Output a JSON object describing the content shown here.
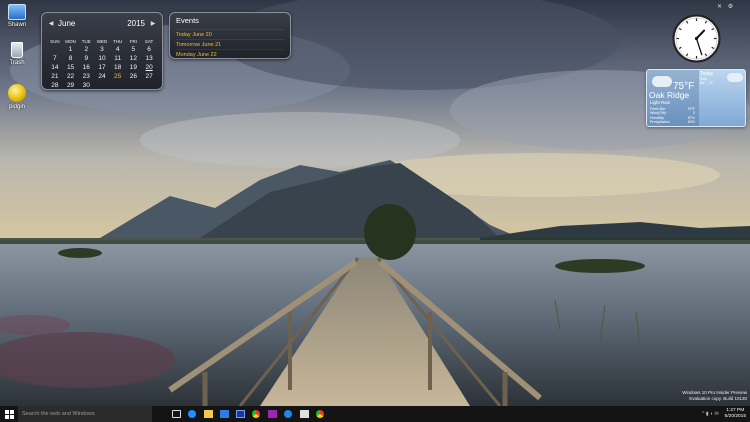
{
  "desktop": {
    "icons": [
      {
        "name": "user-folder",
        "label": "Shawn"
      },
      {
        "name": "recycle-bin",
        "label": "Trash"
      },
      {
        "name": "pidgin",
        "label": "pidgin"
      }
    ]
  },
  "calendar": {
    "month": "June",
    "year": "2015",
    "prev_icon": "chevron-left-icon",
    "next_icon": "chevron-right-icon",
    "weekdays": [
      "SUN",
      "MON",
      "TUE",
      "WED",
      "THU",
      "FRI",
      "SAT"
    ],
    "weeks": [
      [
        "",
        "1",
        "2",
        "3",
        "4",
        "5",
        "6"
      ],
      [
        "7",
        "8",
        "9",
        "10",
        "11",
        "12",
        "13"
      ],
      [
        "14",
        "15",
        "16",
        "17",
        "18",
        "19",
        "20"
      ],
      [
        "21",
        "22",
        "23",
        "24",
        "25",
        "26",
        "27"
      ],
      [
        "28",
        "29",
        "30",
        "",
        "",
        "",
        ""
      ]
    ],
    "today": "25",
    "underlined": "20",
    "today_color": "#f0c020"
  },
  "events": {
    "title": "Events",
    "items": [
      "Today June 20",
      "Tomorrow June 21",
      "Monday June 22"
    ],
    "item_color": "#f0c020"
  },
  "clock": {
    "time_display": "analog",
    "hour": 1,
    "minute": 27,
    "controls": [
      "close-icon",
      "settings-icon"
    ]
  },
  "weather": {
    "current_temp": "75°F",
    "city": "Oak Ridge",
    "condition": "Light Rain",
    "details": [
      {
        "label": "Feels like",
        "value": "75°F"
      },
      {
        "label": "Wind(SW)",
        "value": "0"
      },
      {
        "label": "Humidity",
        "value": "87%"
      },
      {
        "label": "Precipitation",
        "value": "60%"
      }
    ],
    "forecast": {
      "day": "Today",
      "condition": "Rain",
      "temps": "84° - 71°"
    }
  },
  "watermark": {
    "line1": "Windows 10 Pro Insider Preview",
    "line2": "Evaluation copy. Build 10130"
  },
  "taskbar": {
    "search_placeholder": "Search the web and Windows",
    "time": "1:27 PM",
    "date": "6/20/2015",
    "pinned": [
      "task-view",
      "edge",
      "file-explorer",
      "store",
      "app",
      "chrome",
      "app",
      "media-player",
      "app",
      "chrome"
    ],
    "tray_icons": "^ ▮ ◖ ✉"
  }
}
